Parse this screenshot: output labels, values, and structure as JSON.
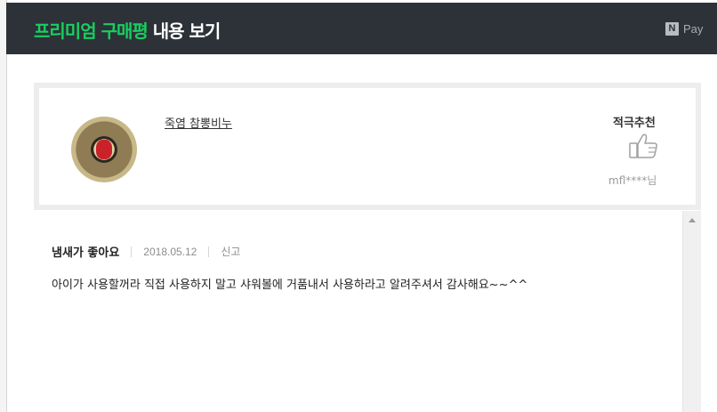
{
  "header": {
    "title_highlight": "프리미엄 구매평",
    "title_rest": " 내용 보기",
    "pay_icon": "N",
    "pay_label": "Pay"
  },
  "product": {
    "name": "죽염 참뽕비누",
    "recommendation": "적극추천",
    "user": "mfl****님",
    "thumbnail_icon": "soap-product-image"
  },
  "review": {
    "title": "냄새가 좋아요",
    "date": "2018.05.12",
    "report_label": "신고",
    "body": "아이가 사용할꺼라 직접 사용하지 말고 샤워볼에 거품내서 사용하라고 알려주셔서 감사해요~~^^"
  },
  "colors": {
    "header_bg": "#2c3238",
    "accent_green": "#19ce60"
  }
}
